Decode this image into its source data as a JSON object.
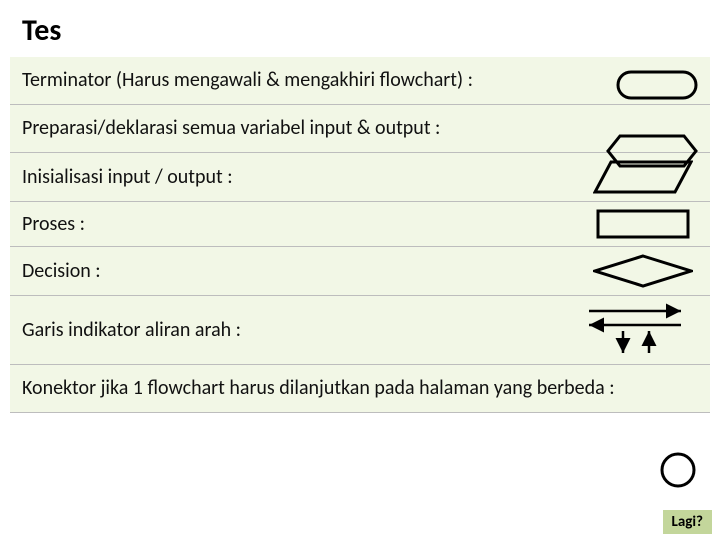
{
  "title": "Tes",
  "rows": {
    "r0": "Terminator (Harus mengawali & mengakhiri flowchart) :",
    "r1": "Preparasi/deklarasi semua variabel input & output :",
    "r2": "Inisialisasi input / output :",
    "r3": "Proses :",
    "r4": "Decision :",
    "r5": "Garis indikator aliran arah :",
    "r6": "Konektor jika 1 flowchart harus dilanjutkan pada halaman yang berbeda :"
  },
  "button": "Lagi?"
}
